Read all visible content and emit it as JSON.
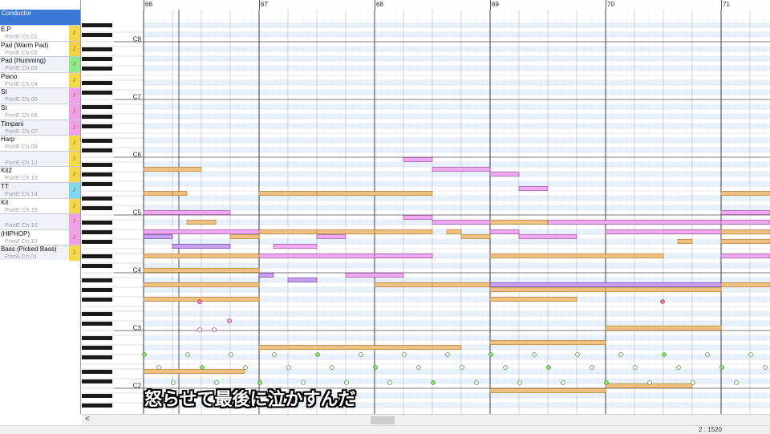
{
  "tracks": {
    "conductor": "Conductor",
    "items": [
      {
        "name": "E.P",
        "port": "PortE  Ch.01",
        "color": "#f5d84a",
        "bg": "#ffffff"
      },
      {
        "name": "Pad (Warm Pad)",
        "port": "PortE  Ch.02",
        "color": "#f3d246",
        "bg": "#ffffff"
      },
      {
        "name": "Pad (Humming)",
        "port": "PortE  Ch.03",
        "color": "#8de88d",
        "bg": "#f0f0f8"
      },
      {
        "name": "Piano",
        "port": "PortE  Ch.04",
        "color": "#f5d84a",
        "bg": "#ffffff"
      },
      {
        "name": "St",
        "port": "PortE  Ch.05",
        "color": "#f0a0e8",
        "bg": "#f0f0f8"
      },
      {
        "name": "St",
        "port": "PortE  Ch.06",
        "color": "#f0a0e8",
        "bg": "#ffffff"
      },
      {
        "name": "Timpani",
        "port": "PortE  Ch.07",
        "color": "#f0a0e8",
        "bg": "#f0f0f8"
      },
      {
        "name": "Harp",
        "port": "PortE  Ch.08",
        "color": "#f5d84a",
        "bg": "#ffffff"
      },
      {
        "name": "",
        "port": "PortE  Ch.12",
        "color": "#f5d84a",
        "bg": "#f0f0f8"
      },
      {
        "name": "Kit2",
        "port": "PortE  Ch.13",
        "color": "#f5d84a",
        "bg": "#ffffff"
      },
      {
        "name": "TT",
        "port": "PortE  Ch.14",
        "color": "#80d8f0",
        "bg": "#f0f0f8"
      },
      {
        "name": "Kit",
        "port": "PortE  Ch.15",
        "color": "#f5d84a",
        "bg": "#ffffff"
      },
      {
        "name": "",
        "port": "PortE  Ch.16",
        "color": "#f0a0e8",
        "bg": "#f0f0f8"
      },
      {
        "name": "(HIPHOP)",
        "port": "PortA  Ch.10",
        "color": "#f0a0e8",
        "bg": "#ffffff"
      },
      {
        "name": "Bass (Picked Bass)",
        "port": "PortA  Ch.01",
        "color": "#f5d84a",
        "bg": "#f0f0f8"
      }
    ]
  },
  "ruler": {
    "measures": [
      "66",
      "67",
      "68",
      "69",
      "70",
      "71"
    ]
  },
  "keyboard": {
    "octave_labels": [
      "C8",
      "C7",
      "C6",
      "C5",
      "C4",
      "C3",
      "C2"
    ]
  },
  "subtitle": "怒らせて最後に泣かすんだ",
  "status": {
    "position": "2 : 1520"
  },
  "scrollbar": {
    "left_arrow": "<"
  },
  "colors": {
    "orange_note": "#f0c080",
    "pink_note": "#f0a8f0",
    "purple_note": "#c8a0f0",
    "grid_bg": "#e8f0fa"
  },
  "notes": [
    {
      "m": 66.0,
      "len": 0.5,
      "pitch": "A5",
      "c": "o"
    },
    {
      "m": 66.0,
      "len": 0.25,
      "pitch": "E5",
      "c": "o"
    },
    {
      "m": 66.25,
      "len": 0.125,
      "pitch": "E5",
      "c": "o"
    },
    {
      "m": 66.0,
      "len": 0.75,
      "pitch": "C5",
      "c": "p"
    },
    {
      "m": 66.375,
      "len": 0.25,
      "pitch": "A#4",
      "c": "o"
    },
    {
      "m": 66.0,
      "len": 1.0,
      "pitch": "G#4",
      "c": "p"
    },
    {
      "m": 66.0,
      "len": 0.25,
      "pitch": "G4",
      "c": "u"
    },
    {
      "m": 66.75,
      "len": 0.25,
      "pitch": "G4",
      "c": "o"
    },
    {
      "m": 66.25,
      "len": 0.5,
      "pitch": "F4",
      "c": "u"
    },
    {
      "m": 66.0,
      "len": 0.5,
      "pitch": "D#4",
      "c": "o"
    },
    {
      "m": 66.5,
      "len": 0.5,
      "pitch": "D#4",
      "c": "o"
    },
    {
      "m": 66.0,
      "len": 1.0,
      "pitch": "C4",
      "c": "o"
    },
    {
      "m": 66.0,
      "len": 1.0,
      "pitch": "A3",
      "c": "o"
    },
    {
      "m": 66.0,
      "len": 1.0,
      "pitch": "F#3",
      "c": "o"
    },
    {
      "m": 67.0,
      "len": 0.5,
      "pitch": "E5",
      "c": "o"
    },
    {
      "m": 67.5,
      "len": 1.0,
      "pitch": "E5",
      "c": "o"
    },
    {
      "m": 67.0,
      "len": 0.5,
      "pitch": "G#4",
      "c": "o"
    },
    {
      "m": 67.5,
      "len": 0.5,
      "pitch": "G#4",
      "c": "o"
    },
    {
      "m": 67.5,
      "len": 0.25,
      "pitch": "G4",
      "c": "p"
    },
    {
      "m": 67.125,
      "len": 0.375,
      "pitch": "F4",
      "c": "p"
    },
    {
      "m": 67.0,
      "len": 1.5,
      "pitch": "D#4",
      "c": "p"
    },
    {
      "m": 67.0,
      "len": 0.125,
      "pitch": "B3",
      "c": "u"
    },
    {
      "m": 67.25,
      "len": 0.25,
      "pitch": "A#3",
      "c": "u"
    },
    {
      "m": 67.75,
      "len": 0.5,
      "pitch": "B3",
      "c": "p"
    },
    {
      "m": 68.25,
      "len": 0.25,
      "pitch": "B5",
      "c": "p"
    },
    {
      "m": 68.5,
      "len": 0.5,
      "pitch": "A5",
      "c": "p"
    },
    {
      "m": 68.25,
      "len": 0.25,
      "pitch": "B4",
      "c": "p"
    },
    {
      "m": 68.5,
      "len": 0.5,
      "pitch": "A#4",
      "c": "p"
    },
    {
      "m": 68.0,
      "len": 0.5,
      "pitch": "G#4",
      "c": "o"
    },
    {
      "m": 68.625,
      "len": 0.125,
      "pitch": "G#4",
      "c": "o"
    },
    {
      "m": 68.75,
      "len": 0.25,
      "pitch": "G4",
      "c": "o"
    },
    {
      "m": 68.0,
      "len": 0.5,
      "pitch": "D#4",
      "c": "p"
    },
    {
      "m": 68.0,
      "len": 0.5,
      "pitch": "A3",
      "c": "o"
    },
    {
      "m": 68.5,
      "len": 0.5,
      "pitch": "A3",
      "c": "o"
    },
    {
      "m": 69.0,
      "len": 0.25,
      "pitch": "G#5",
      "c": "p"
    },
    {
      "m": 69.25,
      "len": 0.25,
      "pitch": "F5",
      "c": "p"
    },
    {
      "m": 69.0,
      "len": 0.5,
      "pitch": "A#4",
      "c": "o"
    },
    {
      "m": 69.0,
      "len": 0.25,
      "pitch": "G#4",
      "c": "p"
    },
    {
      "m": 69.25,
      "len": 0.5,
      "pitch": "G4",
      "c": "p"
    },
    {
      "m": 69.5,
      "len": 1.5,
      "pitch": "A#4",
      "c": "p"
    },
    {
      "m": 69.0,
      "len": 1.5,
      "pitch": "D#4",
      "c": "o"
    },
    {
      "m": 69.0,
      "len": 1.0,
      "pitch": "G#3",
      "c": "o"
    },
    {
      "m": 70.0,
      "len": 1.0,
      "pitch": "G#3",
      "c": "o"
    },
    {
      "m": 69.0,
      "len": 2.0,
      "pitch": "A3",
      "c": "u"
    },
    {
      "m": 69.0,
      "len": 0.75,
      "pitch": "F#3",
      "c": "o"
    },
    {
      "m": 70.0,
      "len": 1.0,
      "pitch": "C3",
      "c": "o"
    },
    {
      "m": 69.0,
      "len": 1.0,
      "pitch": "A2",
      "c": "o"
    },
    {
      "m": 70.5,
      "len": 0.5,
      "pitch": "G#4",
      "c": "o"
    },
    {
      "m": 70.625,
      "len": 0.125,
      "pitch": "F#4",
      "c": "o"
    },
    {
      "m": 70.0,
      "len": 1.0,
      "pitch": "G#4",
      "c": "p"
    },
    {
      "m": 70.0,
      "len": 0.75,
      "pitch": "C2",
      "c": "o"
    },
    {
      "m": 69.0,
      "len": 1.0,
      "pitch": "B1",
      "c": "o"
    },
    {
      "m": 71.0,
      "len": 0.5,
      "pitch": "E5",
      "c": "o"
    },
    {
      "m": 71.0,
      "len": 0.5,
      "pitch": "C5",
      "c": "p"
    },
    {
      "m": 71.0,
      "len": 0.5,
      "pitch": "A#4",
      "c": "p"
    },
    {
      "m": 71.0,
      "len": 0.5,
      "pitch": "G#4",
      "c": "o"
    },
    {
      "m": 71.0,
      "len": 0.5,
      "pitch": "F#4",
      "c": "o"
    },
    {
      "m": 71.0,
      "len": 0.5,
      "pitch": "D#4",
      "c": "p"
    },
    {
      "m": 71.0,
      "len": 0.5,
      "pitch": "A3",
      "c": "o"
    },
    {
      "m": 66.0,
      "len": 0.875,
      "pitch": "D#2",
      "c": "o"
    },
    {
      "m": 67.0,
      "len": 1.75,
      "pitch": "G#2",
      "c": "o"
    }
  ]
}
